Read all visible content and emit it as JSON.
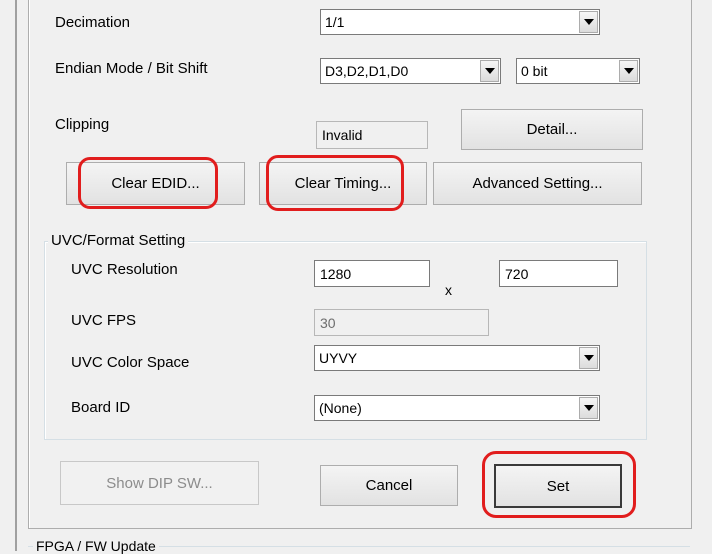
{
  "settings": {
    "decimation_label": "Decimation",
    "decimation_value": "1/1",
    "endian_label": "Endian Mode / Bit Shift",
    "endian_value": "D3,D2,D1,D0",
    "bitshift_value": "0 bit",
    "clipping_label": "Clipping",
    "clipping_value": "Invalid",
    "detail_label": "Detail..."
  },
  "actions": {
    "clear_edid": "Clear EDID...",
    "clear_timing": "Clear Timing...",
    "advanced_setting": "Advanced Setting..."
  },
  "uvc": {
    "group_title": "UVC/Format Setting",
    "resolution_label": "UVC Resolution",
    "width": "1280",
    "times": "x",
    "height": "720",
    "fps_label": "UVC FPS",
    "fps_value": "30",
    "color_space_label": "UVC Color Space",
    "color_space_value": "UYVY",
    "board_id_label": "Board ID",
    "board_id_value": "(None)"
  },
  "footer": {
    "show_dip": "Show DIP SW...",
    "cancel": "Cancel",
    "set": "Set"
  },
  "next_section": {
    "title": "FPGA / FW Update"
  },
  "colors": {
    "highlight": "#e11d1d",
    "dialog_bg": "#f0f0f0"
  }
}
